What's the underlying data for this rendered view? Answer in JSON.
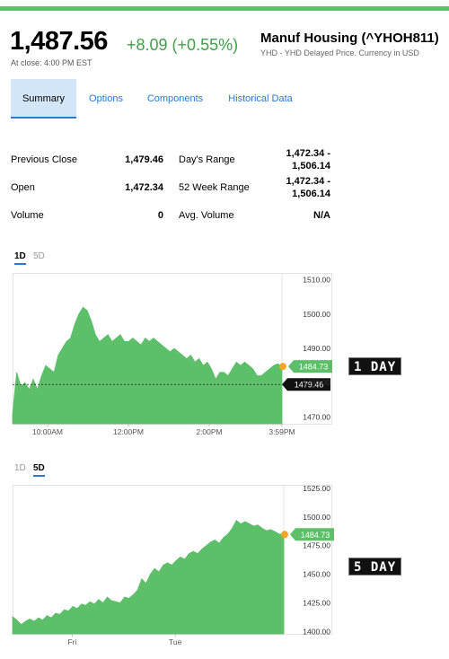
{
  "quote": {
    "price": "1,487.56",
    "change": "+8.09 (+0.55%)",
    "close_time": "At close: 4:00 PM EST",
    "name": "Manuf Housing (^YHOH811)",
    "subtitle": "YHD - YHD Delayed Price. Currency in USD"
  },
  "tabs": [
    {
      "label": "Summary"
    },
    {
      "label": "Options"
    },
    {
      "label": "Components"
    },
    {
      "label": "Historical Data"
    }
  ],
  "stats": [
    {
      "label1": "Previous Close",
      "value1": "1,479.46",
      "label2": "Day's Range",
      "value2": "1,472.34 - 1,506.14"
    },
    {
      "label1": "Open",
      "value1": "1,472.34",
      "label2": "52 Week Range",
      "value2": "1,472.34 - 1,506.14"
    },
    {
      "label1": "Volume",
      "value1": "0",
      "label2": "Avg. Volume",
      "value2": "N/A"
    }
  ],
  "range_tabs": {
    "d1": "1D",
    "d5": "5D"
  },
  "labels": {
    "day1": "1 DAY",
    "day5": "5 DAY"
  },
  "colors": {
    "fill": "#5dbf6a",
    "marker": "#f5a623",
    "accent": "#2a7ad3"
  },
  "chart_data": [
    {
      "type": "area",
      "ylim": [
        1468,
        1512
      ],
      "yticks": [
        1510.0,
        1500.0,
        1490.0,
        1480.0,
        1470.0
      ],
      "ytick_labels": [
        "1510.00",
        "1500.00",
        "1490.00",
        "1480.00",
        "1470.00"
      ],
      "xtick_labels": [
        "10:00AM",
        "12:00PM",
        "2:00PM",
        "3:59PM"
      ],
      "xtick_pos": [
        0.13,
        0.43,
        0.73,
        1.0
      ],
      "current_label": "1484.73",
      "current_value": 1484.73,
      "prev_close_label": "1479.46",
      "prev_close_value": 1479.46,
      "values": [
        1471,
        1483,
        1479,
        1480,
        1478,
        1481,
        1478,
        1482,
        1485,
        1484,
        1483,
        1488,
        1490,
        1492,
        1493,
        1497,
        1500,
        1502,
        1501,
        1498,
        1494,
        1492,
        1493,
        1494,
        1492,
        1493,
        1494,
        1492,
        1492,
        1493,
        1492,
        1491,
        1493,
        1492,
        1493,
        1492,
        1491,
        1490,
        1489,
        1490,
        1489,
        1488,
        1487,
        1488,
        1486,
        1487,
        1485,
        1486,
        1484,
        1481,
        1483,
        1483,
        1482,
        1484,
        1486,
        1485,
        1486,
        1485,
        1484,
        1482,
        1482,
        1483,
        1484,
        1485,
        1485.5,
        1484.7
      ]
    },
    {
      "type": "area",
      "ylim": [
        1398,
        1528
      ],
      "yticks": [
        1525.0,
        1500.0,
        1475.0,
        1450.0,
        1425.0,
        1400.0
      ],
      "ytick_labels": [
        "1525.00",
        "1500.00",
        "1475.00",
        "1450.00",
        "1425.00",
        "1400.00"
      ],
      "xtick_labels": [
        "Fri",
        "Tue"
      ],
      "xtick_pos": [
        0.22,
        0.6
      ],
      "current_label": "1484.73",
      "current_value": 1484.73,
      "values": [
        1413,
        1410,
        1406,
        1409,
        1411,
        1409,
        1412,
        1410,
        1414,
        1412,
        1416,
        1415,
        1419,
        1418,
        1422,
        1420,
        1424,
        1423,
        1426,
        1424,
        1428,
        1425,
        1430,
        1427,
        1426,
        1425,
        1430,
        1429,
        1432,
        1436,
        1446,
        1442,
        1450,
        1455,
        1452,
        1458,
        1460,
        1458,
        1462,
        1465,
        1463,
        1468,
        1470,
        1468,
        1472,
        1475,
        1478,
        1480,
        1477,
        1482,
        1485,
        1490,
        1497,
        1494,
        1496,
        1494,
        1492,
        1493,
        1490,
        1488,
        1489,
        1487,
        1485,
        1484.7
      ]
    }
  ]
}
